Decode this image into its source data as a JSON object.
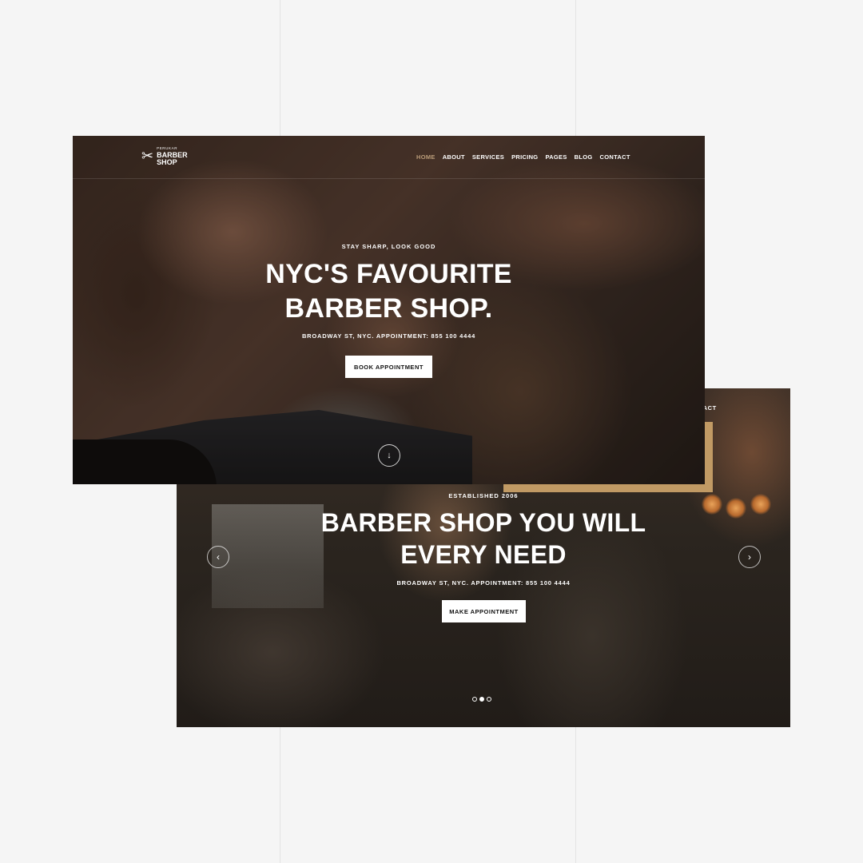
{
  "background": {
    "color": "#f5f5f5",
    "accent": "#c19a64"
  },
  "front": {
    "logo": {
      "small": "PERUKAR",
      "big1": "BARBER",
      "big2": "SHOP",
      "icon": "scissors-icon"
    },
    "nav": [
      {
        "label": "HOME",
        "active": true
      },
      {
        "label": "ABOUT"
      },
      {
        "label": "SERVICES"
      },
      {
        "label": "PRICING"
      },
      {
        "label": "PAGES"
      },
      {
        "label": "BLOG"
      },
      {
        "label": "CONTACT"
      }
    ],
    "eyebrow": "STAY SHARP, LOOK GOOD",
    "title_line1": "NYC'S FAVOURITE",
    "title_line2": "BARBER SHOP.",
    "address": "BROADWAY ST, NYC. APPOINTMENT: 855 100 4444",
    "button": "BOOK APPOINTMENT",
    "scroll_icon": "arrow-down-icon"
  },
  "back": {
    "nav_peek": "TACT",
    "eyebrow": "ESTABLISHED 2006",
    "title_line1": "BARBER SHOP YOU WILL",
    "title_line2": "EVERY NEED",
    "address": "BROADWAY ST, NYC. APPOINTMENT: 855 100 4444",
    "button": "MAKE APPOINTMENT",
    "prev_icon": "‹",
    "next_icon": "›",
    "slides": 3,
    "active_slide": 2
  }
}
